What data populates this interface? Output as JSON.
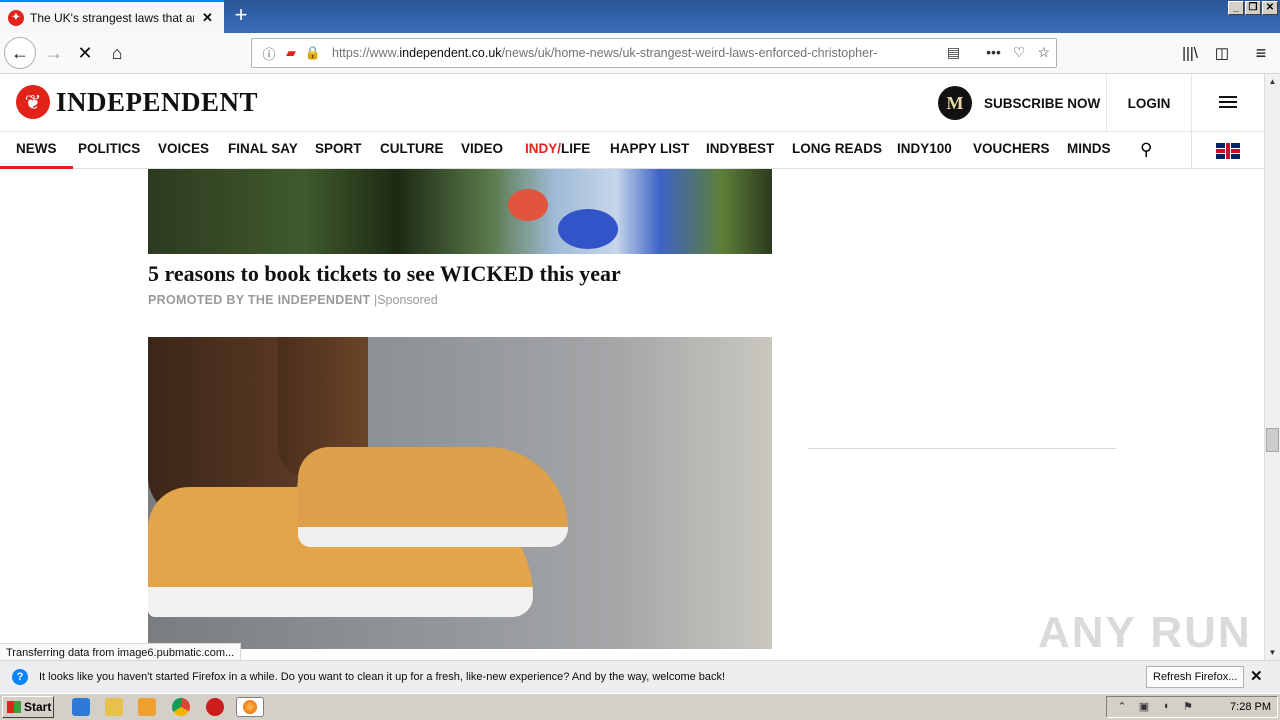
{
  "browser": {
    "tab_title": "The UK's strangest laws that are s",
    "url_prefix": "https://www.",
    "url_domain": "independent.co.uk",
    "url_path": "/news/uk/home-news/uk-strangest-weird-laws-enforced-christopher-",
    "status_text": "Transferring data from image6.pubmatic.com..."
  },
  "site": {
    "logo_text": "INDEPENDENT",
    "subscribe_badge": "M",
    "subscribe_label": "SUBSCRIBE NOW",
    "login_label": "LOGIN",
    "sections": {
      "news": "NEWS",
      "politics": "POLITICS",
      "voices": "VOICES",
      "final_say": "FINAL SAY",
      "sport": "SPORT",
      "culture": "CULTURE",
      "video": "VIDEO",
      "indy_prefix": "INDY/",
      "indy_suffix": "LIFE",
      "happy_list": "HAPPY LIST",
      "indybest": "INDYBEST",
      "long_reads": "LONG READS",
      "indy100": "INDY100",
      "vouchers": "VOUCHERS",
      "minds": "MINDS"
    }
  },
  "content": {
    "headline1": "5 reasons to book tickets to see WICKED this year",
    "promo_label": "PROMOTED BY THE INDEPENDENT",
    "promo_sponsored": "Sponsored"
  },
  "notification": {
    "message": "It looks like you haven't started Firefox in a while. Do you want to clean it up for a fresh, like-new experience? And by the way, welcome back!",
    "refresh_label": "Refresh Firefox..."
  },
  "taskbar": {
    "start_label": "Start",
    "clock": "7:28 PM"
  },
  "watermark": "ANY RUN",
  "colors": {
    "brand_red": "#e2231a",
    "firefox_blue": "#0a84ff"
  },
  "icons": [
    "back-icon",
    "forward-icon",
    "stop-icon",
    "home-icon",
    "info-icon",
    "lock-icon",
    "reader-icon",
    "more-icon",
    "pocket-icon",
    "star-icon",
    "library-icon",
    "sidebar-icon",
    "hamburger-icon",
    "search-icon",
    "uk-flag-icon"
  ]
}
